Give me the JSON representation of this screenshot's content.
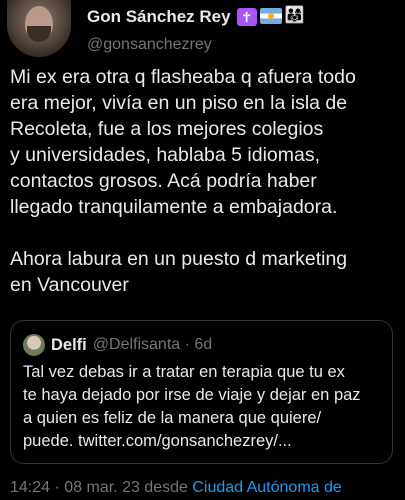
{
  "author": {
    "display_name": "Gon Sánchez Rey",
    "handle": "@gonsanchezrey",
    "badges": [
      "latin-cross-emoji",
      "argentina-flag-emoji",
      "family-emoji"
    ],
    "badge_cross_glyph": "✝"
  },
  "tweet": {
    "text": "Mi ex era otra q flasheaba q afuera todo\nera mejor, vivía en un piso en la isla de\nRecoleta, fue a los mejores colegios\ny universidades, hablaba 5 idiomas,\ncontactos grosos. Acá podría haber\nllegado tranquilamente a embajadora.\n\nAhora labura en un puesto d marketing\nen Vancouver"
  },
  "quoted_tweet": {
    "display_name": "Delfi",
    "handle_time": "@Delfisanta · 6d",
    "text": "Tal vez debas ir a tratar en terapia que tu ex\nte haya dejado por irse de viaje y dejar en paz\na quien es feliz de la manera que quiere/\npuede. twitter.com/gonsanchezrey/..."
  },
  "meta": {
    "datetime": "14:24 · 08 mar. 23 desde ",
    "location": "Ciudad Autónoma de"
  },
  "colors": {
    "background": "#000000",
    "text": "#e7e9ea",
    "secondary": "#71767b",
    "link": "#1d9bf0",
    "border": "#2f3336"
  }
}
